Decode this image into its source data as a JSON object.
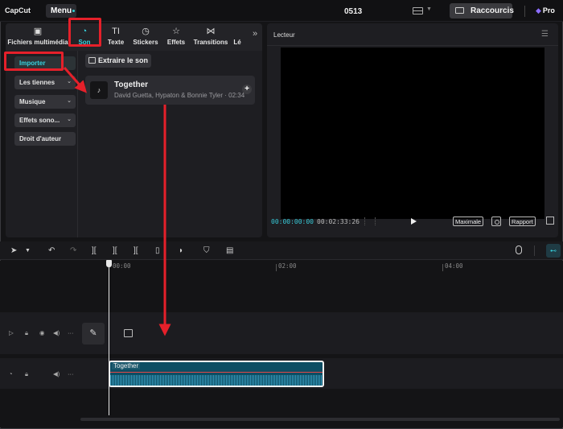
{
  "app": {
    "logo": "CapCut",
    "menu_label": "Menu",
    "project_title": "0513",
    "shortcuts_label": "Raccourcis",
    "pro_label": "Pro"
  },
  "tabs": [
    {
      "label": "Fichiers multimédia",
      "icon": "media-icon",
      "active": false
    },
    {
      "label": "Son",
      "icon": "audio-icon",
      "active": true
    },
    {
      "label": "Texte",
      "icon": "text-icon",
      "active": false
    },
    {
      "label": "Stickers",
      "icon": "sticker-icon",
      "active": false
    },
    {
      "label": "Effets",
      "icon": "effects-icon",
      "active": false
    },
    {
      "label": "Transitions",
      "icon": "transitions-icon",
      "active": false
    },
    {
      "label": "Lé",
      "icon": "",
      "active": false
    }
  ],
  "sidebar": {
    "items": [
      {
        "label": "Importer",
        "active": true,
        "caret": false
      },
      {
        "label": "Les tiennes",
        "active": false,
        "caret": true
      },
      {
        "label": "Musique",
        "active": false,
        "caret": true
      },
      {
        "label": "Effets sono...",
        "active": false,
        "caret": true
      },
      {
        "label": "Droit d'auteur",
        "active": false,
        "caret": false
      }
    ]
  },
  "media": {
    "extract_label": "Extraire le son",
    "track": {
      "title": "Together",
      "subtitle": "David Guetta, Hypaton & Bonnie Tyler · 02:34"
    }
  },
  "player": {
    "title": "Lecteur",
    "current_time": "00:00:00:00",
    "duration": "00:02:33:26",
    "maximize_label": "Maximale",
    "ratio_label": "Rapport"
  },
  "timeline": {
    "ruler": [
      "00:00",
      "02:00",
      "04:00"
    ],
    "clip_name": "Together"
  },
  "colors": {
    "accent": "#37d3e0",
    "annotation": "#e5202a",
    "clip": "#0d4d63"
  }
}
